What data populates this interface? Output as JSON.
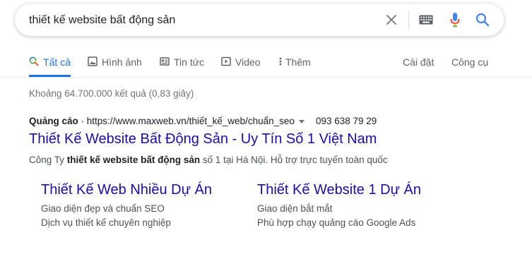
{
  "search": {
    "query": "thiết kế website bất động sản"
  },
  "tabs": [
    {
      "label": "Tất cả",
      "icon": "search-icon",
      "active": true
    },
    {
      "label": "Hình ảnh",
      "icon": "image-icon"
    },
    {
      "label": "Tin tức",
      "icon": "news-icon"
    },
    {
      "label": "Video",
      "icon": "video-icon"
    },
    {
      "label": "Thêm",
      "icon": "more-vert-icon"
    }
  ],
  "tools": {
    "settings_label": "Cài đặt",
    "tools_label": "Công cụ"
  },
  "stats": {
    "text": "Khoảng 64.700.000 kết quả (0,83 giây)"
  },
  "ad": {
    "label": "Quảng cáo",
    "separator": " · ",
    "url": "https://www.maxweb.vn/thiết_kế_web/chuẩn_seo",
    "phone": "093 638 79 29",
    "title": "Thiết Kế Website Bất Động Sản - Uy Tín Số 1 Việt Nam",
    "desc_prefix": "Công Ty ",
    "desc_bold": "thiết kế website bất động sản",
    "desc_suffix": " số 1 tại Hà Nội. Hỗ trợ trực tuyến toàn quốc",
    "sitelinks": [
      {
        "title": "Thiết Kế Web Nhiều Dự Án",
        "line1": "Giao diện đẹp và chuẩn SEO",
        "line2": "Dịch vụ thiết kế chuyên nghiệp"
      },
      {
        "title": "Thiết Kế Website 1 Dự Án",
        "line1": "Giao diện bắt mắt",
        "line2": "Phù hợp chạy quảng cáo Google Ads"
      }
    ]
  },
  "colors": {
    "link": "#1a0dab",
    "accent": "#1a73e8",
    "muted": "#70757a"
  }
}
